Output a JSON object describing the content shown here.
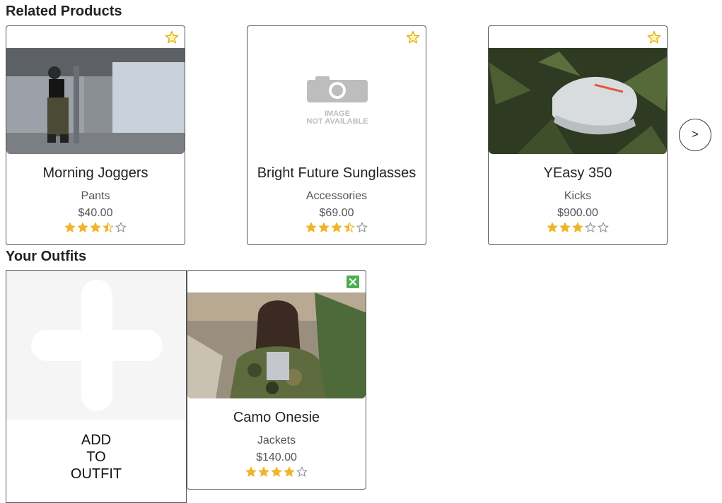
{
  "related": {
    "title": "Related Products",
    "next_label": ">",
    "items": [
      {
        "name": "Morning Joggers",
        "category": "Pants",
        "price": "$40.00",
        "rating": 3.5,
        "image": "photo-person-joggers"
      },
      {
        "name": "Bright Future Sunglasses",
        "category": "Accessories",
        "price": "$69.00",
        "rating": 3.5,
        "image": "image-not-available",
        "placeholder_line1": "IMAGE",
        "placeholder_line2": "NOT AVAILABLE"
      },
      {
        "name": "YEasy 350",
        "category": "Kicks",
        "price": "$900.00",
        "rating": 3,
        "image": "photo-sneaker-ferns"
      }
    ]
  },
  "outfits": {
    "title": "Your Outfits",
    "add_label": [
      "ADD",
      "TO",
      "OUTFIT"
    ],
    "items": [
      {
        "name": "Camo Onesie",
        "category": "Jackets",
        "price": "$140.00",
        "rating": 4,
        "image": "photo-person-camo-jacket"
      }
    ]
  },
  "colors": {
    "star": "#f0b429",
    "remove": "#4caf50",
    "border": "#555555"
  },
  "icons": {
    "favorite": "star-outline-icon",
    "remove": "close-square-icon",
    "add": "plus-icon"
  }
}
